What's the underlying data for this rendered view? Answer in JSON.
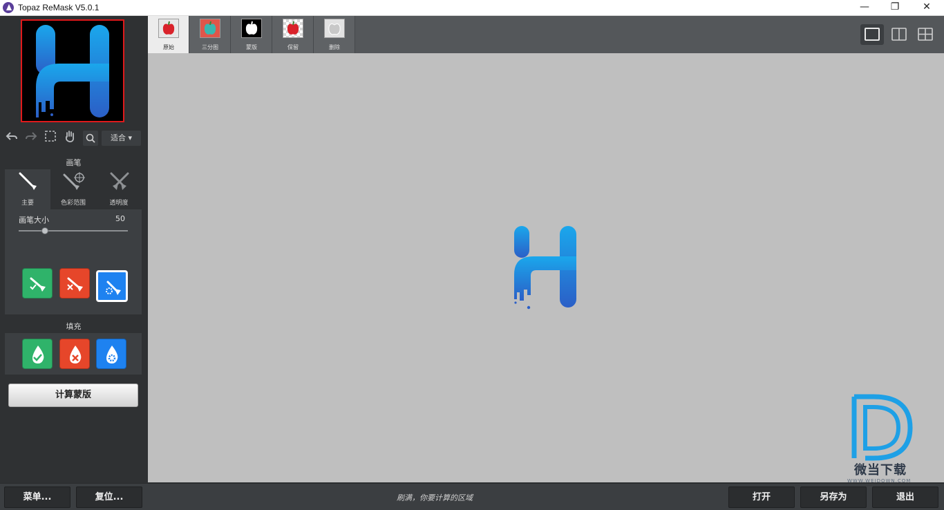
{
  "window": {
    "title": "Topaz ReMask V5.0.1",
    "minimize_glyph": "—",
    "maximize_glyph": "❐",
    "close_glyph": "✕"
  },
  "toolbar": {
    "zoom_select": "适合 ▾",
    "icons": [
      "undo-icon",
      "redo-icon",
      "marquee-icon",
      "hand-icon",
      "search-icon"
    ]
  },
  "brush": {
    "section_title": "画笔",
    "tabs": [
      {
        "label": "主要",
        "icon": "brush-icon",
        "active": true
      },
      {
        "label": "色彩范围",
        "icon": "color-range-brush-icon",
        "active": false
      },
      {
        "label": "透明度",
        "icon": "transparency-brush-icon",
        "active": false
      }
    ],
    "size_label": "画笔大小",
    "size_value": "50",
    "size_level": 50
  },
  "fill": {
    "section_title": "填充"
  },
  "compute_button": "计算蒙版",
  "view_tabs": [
    {
      "label": "原始",
      "active": true
    },
    {
      "label": "三分图",
      "active": false
    },
    {
      "label": "蒙版",
      "active": false
    },
    {
      "label": "保留",
      "active": false
    },
    {
      "label": "删除",
      "active": false
    }
  ],
  "watermark": {
    "text": "微当下载",
    "url": "WWW.WEIDOWN.COM"
  },
  "bottom": {
    "menu_button": "菜单...",
    "reset_button": "复位...",
    "status_text": "刷满，你要计算的区域",
    "open_button": "打开",
    "save_as_button": "另存为",
    "exit_button": "退出"
  },
  "colors": {
    "keep_green": "#2fb36a",
    "remove_red": "#e6462a",
    "compute_blue": "#1e82f0",
    "logo_top": "#1aa7ec",
    "logo_bottom": "#2b5fc7"
  }
}
